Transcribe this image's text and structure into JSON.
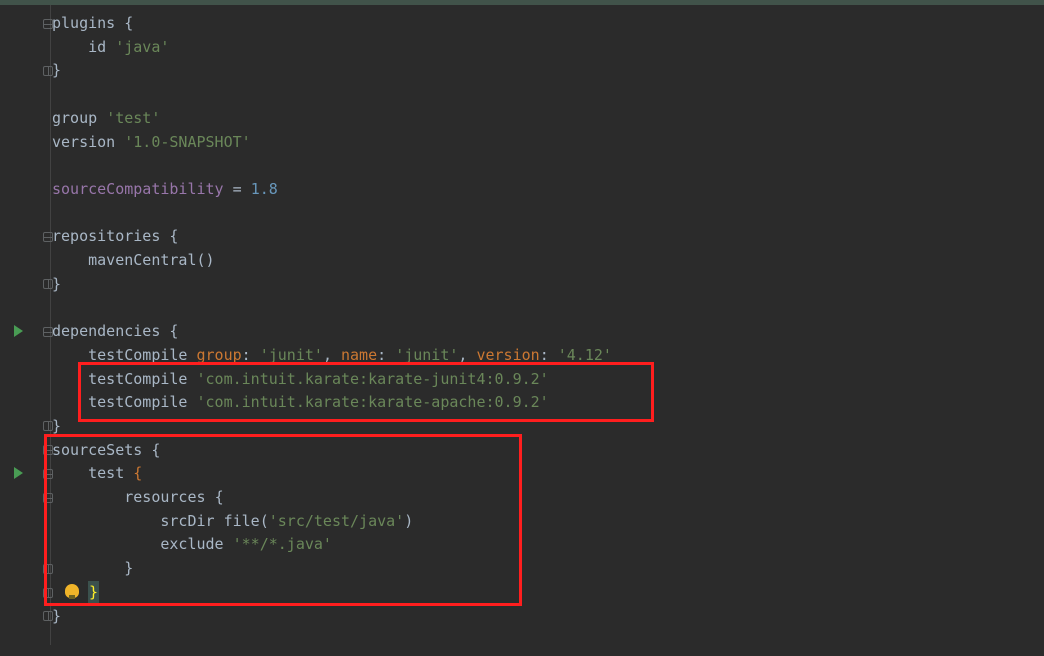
{
  "code": {
    "l1a": "plugins ",
    "l1b": "{",
    "l2a": "    id ",
    "l2b": "'java'",
    "l3": "}",
    "l5a": "group ",
    "l5b": "'test'",
    "l6a": "version ",
    "l6b": "'1.0-SNAPSHOT'",
    "l8a": "sourceCompatibility",
    "l8b": " = ",
    "l8c": "1.8",
    "l10a": "repositories ",
    "l10b": "{",
    "l11": "    mavenCentral()",
    "l12": "}",
    "l14a": "dependencies ",
    "l14b": "{",
    "l15a": "    testCompile ",
    "l15b": "group",
    "l15c": ": ",
    "l15d": "'junit'",
    "l15e": ", ",
    "l15f": "name",
    "l15g": ": ",
    "l15h": "'junit'",
    "l15i": ", ",
    "l15j": "version",
    "l15k": ": ",
    "l15l": "'4.12'",
    "l16a": "    testCompile ",
    "l16b": "'com.intuit.karate:karate-junit4:0.9.2'",
    "l17a": "    testCompile ",
    "l17b": "'com.intuit.karate:karate-apache:0.9.2'",
    "l18": "}",
    "l19a": "sourceSets ",
    "l19b": "{",
    "l20a": "    test ",
    "l20b": "{",
    "l21a": "        resources ",
    "l21b": "{",
    "l22a": "            srcDir file(",
    "l22b": "'src/test/java'",
    "l22c": ")",
    "l23a": "            exclude ",
    "l23b": "'**/*.java'",
    "l24": "        }",
    "l25": "    ",
    "l25b": "}",
    "l26": "}"
  }
}
